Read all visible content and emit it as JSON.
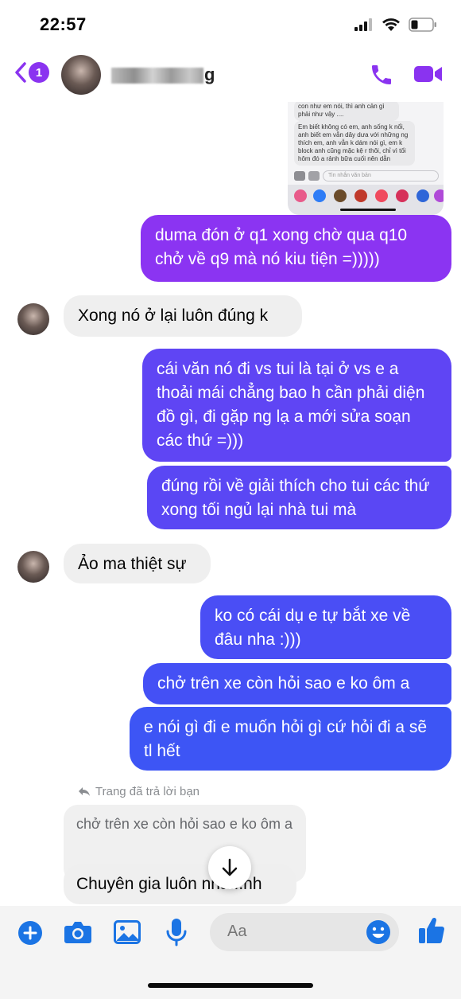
{
  "status_bar": {
    "time": "22:57"
  },
  "header": {
    "back_badge": "1",
    "contact_name_visible": "g"
  },
  "screenshot": {
    "bubble1": "con như em nói, thì anh cản gì phải như vậy ....",
    "bubble2": "Em biết không có em, anh sống k nổi, anh biết em vẫn dây dưa với những ng thích em, anh vẫn k dám nói gì, em k block anh cũng mặc kệ r thôi, chỉ vì tối hôm đó a rảnh bữa cuối nên dẫn",
    "input_placeholder": "Tin nhắn văn bản"
  },
  "messages": {
    "out1": "duma đón ở q1 xong chờ qua q10 chở về q9 mà nó kiu tiện =)))))",
    "in1": "Xong nó ở lại luôn đúng k",
    "out2": "cái văn nó đi vs tui là tại ở vs e a thoải mái chẳng bao h cần phải diện đồ gì, đi gặp ng lạ a mới sửa soạn các thứ =)))",
    "out3": "đúng rồi về giải thích cho tui các thứ xong tối ngủ lại nhà tui mà",
    "in2": "Ảo ma thiệt sự",
    "out4": "ko có cái dụ e tự bắt xe về đâu nha :)))",
    "out5": "chở trên xe còn hỏi sao e ko ôm a",
    "out6": "e nói gì đi e muốn hỏi gì cứ hỏi đi a sẽ tl hết"
  },
  "reply": {
    "label": "Trang đã trả lời bạn",
    "quoted": "chở trên xe còn hỏi sao e ko ôm a",
    "text": "Chuyên gia luôn nha...hh"
  },
  "composer": {
    "placeholder": "Aa"
  },
  "colors": {
    "accent": "#8a33f0",
    "bubble_purple": "#8b34f2",
    "bubble_blue": "#3d55f5"
  }
}
